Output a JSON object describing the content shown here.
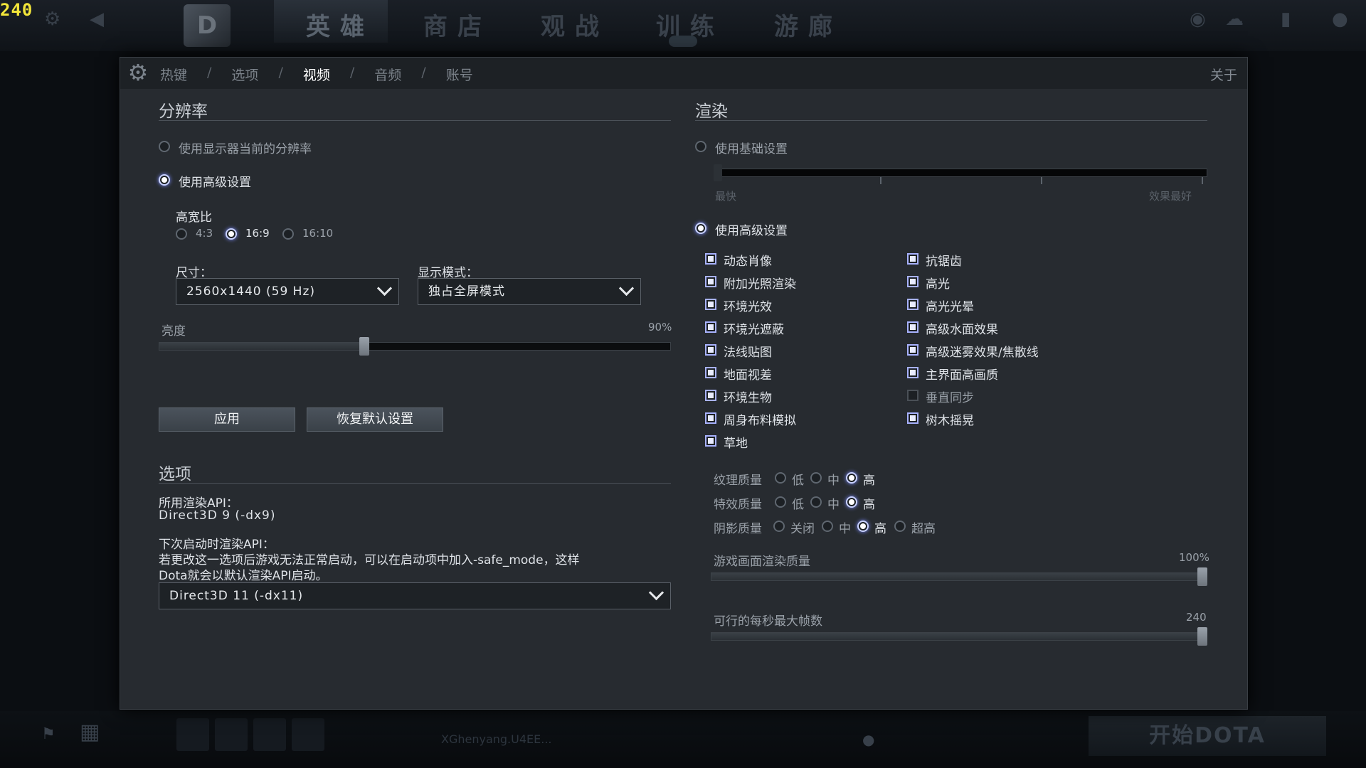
{
  "fps": "240",
  "top_nav": [
    "英雄",
    "商店",
    "观战",
    "训练",
    "游廊"
  ],
  "bottom_bar": {
    "player_text": "XGhenyang.U4EE...",
    "start_button": "开始DOTA"
  },
  "header": {
    "tabs": [
      "热键",
      "选项",
      "视频",
      "音频",
      "账号"
    ],
    "active_tab": "视频",
    "separator": "/",
    "about": "关于"
  },
  "resolution": {
    "title": "分辨率",
    "use_monitor": "使用显示器当前的分辨率",
    "use_advanced": "使用高级设置",
    "aspect_label": "高宽比",
    "aspects": [
      "4:3",
      "16:9",
      "16:10"
    ],
    "selected_aspect": "16:9",
    "size_label": "尺寸：",
    "size_value": "2560x1440 (59 Hz)",
    "display_mode_label": "显示模式：",
    "display_mode_value": "独占全屏模式",
    "brightness_label": "亮度",
    "brightness_value_text": "90%",
    "brightness_fraction": 0.4,
    "apply": "应用",
    "restore_defaults": "恢复默认设置"
  },
  "options": {
    "title": "选项",
    "api_label": "所用渲染API：",
    "api_value": "Direct3D 9 (-dx9)",
    "next_api_label": "下次启动时渲染API：",
    "next_api_note_line1": "若更改这一选项后游戏无法正常启动，可以在启动项中加入-safe_mode，这样",
    "next_api_note_line2": "Dota就会以默认渲染API启动。",
    "next_api_value": "Direct3D 11 (-dx11)"
  },
  "rendering": {
    "title": "渲染",
    "use_basic": "使用基础设置",
    "basic_slider_min": "最快",
    "basic_slider_max": "效果最好",
    "use_advanced": "使用高级设置",
    "checkboxes_left": [
      {
        "label": "动态肖像",
        "checked": true
      },
      {
        "label": "附加光照渲染",
        "checked": true
      },
      {
        "label": "环境光效",
        "checked": true
      },
      {
        "label": "环境光遮蔽",
        "checked": true
      },
      {
        "label": "法线贴图",
        "checked": true
      },
      {
        "label": "地面视差",
        "checked": true
      },
      {
        "label": "环境生物",
        "checked": true
      },
      {
        "label": "周身布料模拟",
        "checked": true
      },
      {
        "label": "草地",
        "checked": true
      }
    ],
    "checkboxes_right": [
      {
        "label": "抗锯齿",
        "checked": true
      },
      {
        "label": "高光",
        "checked": true
      },
      {
        "label": "高光光晕",
        "checked": true
      },
      {
        "label": "高级水面效果",
        "checked": true
      },
      {
        "label": "高级迷雾效果/焦散线",
        "checked": true
      },
      {
        "label": "主界面高画质",
        "checked": true
      },
      {
        "label": "垂直同步",
        "checked": false
      },
      {
        "label": "树木摇晃",
        "checked": true
      }
    ],
    "texture_quality": {
      "label": "纹理质量",
      "options": [
        "低",
        "中",
        "高"
      ],
      "selected": "高"
    },
    "effects_quality": {
      "label": "特效质量",
      "options": [
        "低",
        "中",
        "高"
      ],
      "selected": "高"
    },
    "shadow_quality": {
      "label": "阴影质量",
      "options": [
        "关闭",
        "中",
        "高",
        "超高"
      ],
      "selected": "高"
    },
    "render_quality_label": "游戏画面渲染质量",
    "render_quality_value": "100%",
    "render_quality_fraction": 1.0,
    "max_fps_label": "可行的每秒最大帧数",
    "max_fps_value": "240",
    "max_fps_fraction": 1.0
  },
  "colors": {
    "accent": "#a8b2ff",
    "panel_bg": "#272b30",
    "fps_yellow": "#f3e63a"
  }
}
